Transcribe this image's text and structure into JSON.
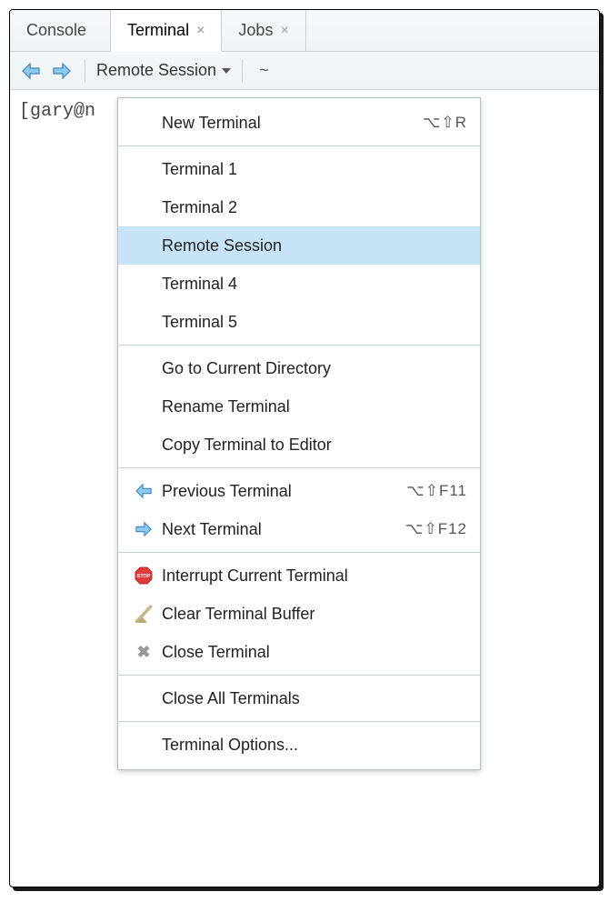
{
  "tabs": {
    "console": "Console",
    "terminal": "Terminal",
    "jobs": "Jobs"
  },
  "toolbar": {
    "dropdown_label": "Remote Session",
    "path": "~"
  },
  "terminal": {
    "prompt": "[gary@n"
  },
  "menu": {
    "new_terminal": "New Terminal",
    "new_terminal_shortcut": "⌥⇧R",
    "terminal_1": "Terminal 1",
    "terminal_2": "Terminal 2",
    "remote_session": "Remote Session",
    "terminal_4": "Terminal 4",
    "terminal_5": "Terminal 5",
    "go_current_dir": "Go to Current Directory",
    "rename_terminal": "Rename Terminal",
    "copy_to_editor": "Copy Terminal to Editor",
    "prev_terminal": "Previous Terminal",
    "prev_shortcut": "⌥⇧F11",
    "next_terminal": "Next Terminal",
    "next_shortcut": "⌥⇧F12",
    "interrupt": "Interrupt Current Terminal",
    "clear_buffer": "Clear Terminal Buffer",
    "close_terminal": "Close Terminal",
    "close_all": "Close All Terminals",
    "options": "Terminal Options..."
  }
}
